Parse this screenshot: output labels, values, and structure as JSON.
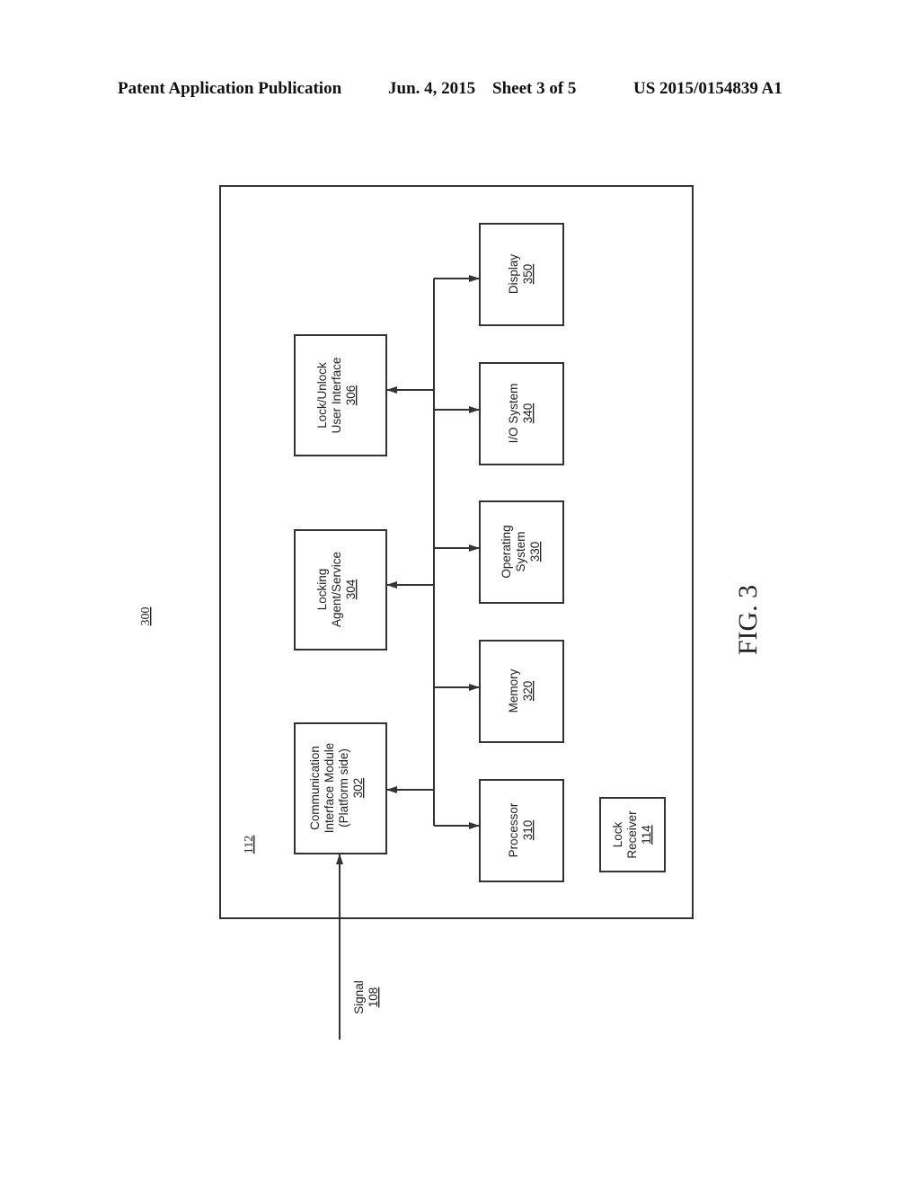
{
  "header": {
    "publication": "Patent Application Publication",
    "date": "Jun. 4, 2015",
    "sheet": "Sheet 3 of 5",
    "number": "US 2015/0154839 A1"
  },
  "figure": {
    "label": "FIG. 3",
    "diagram_ref": "300",
    "platform_ref": "112"
  },
  "signal": {
    "label": "Signal",
    "ref": "108"
  },
  "upper_modules": [
    {
      "lines": [
        "Communication",
        "Interface Module",
        "(Platform side)"
      ],
      "ref": "302"
    },
    {
      "lines": [
        "Locking",
        "Agent/Service"
      ],
      "ref": "304"
    },
    {
      "lines": [
        "Lock/Unlock",
        "User Interface"
      ],
      "ref": "306"
    }
  ],
  "lower_modules": [
    {
      "lines": [
        "Processor"
      ],
      "ref": "310"
    },
    {
      "lines": [
        "Memory"
      ],
      "ref": "320"
    },
    {
      "lines": [
        "Operating",
        "System"
      ],
      "ref": "330"
    },
    {
      "lines": [
        "I/O System"
      ],
      "ref": "340"
    },
    {
      "lines": [
        "Display"
      ],
      "ref": "350"
    }
  ],
  "lock_receiver": {
    "lines": [
      "Lock",
      "Receiver"
    ],
    "ref": "114"
  },
  "colors": {
    "line": "#333333",
    "text": "#222222",
    "background": "#ffffff"
  }
}
